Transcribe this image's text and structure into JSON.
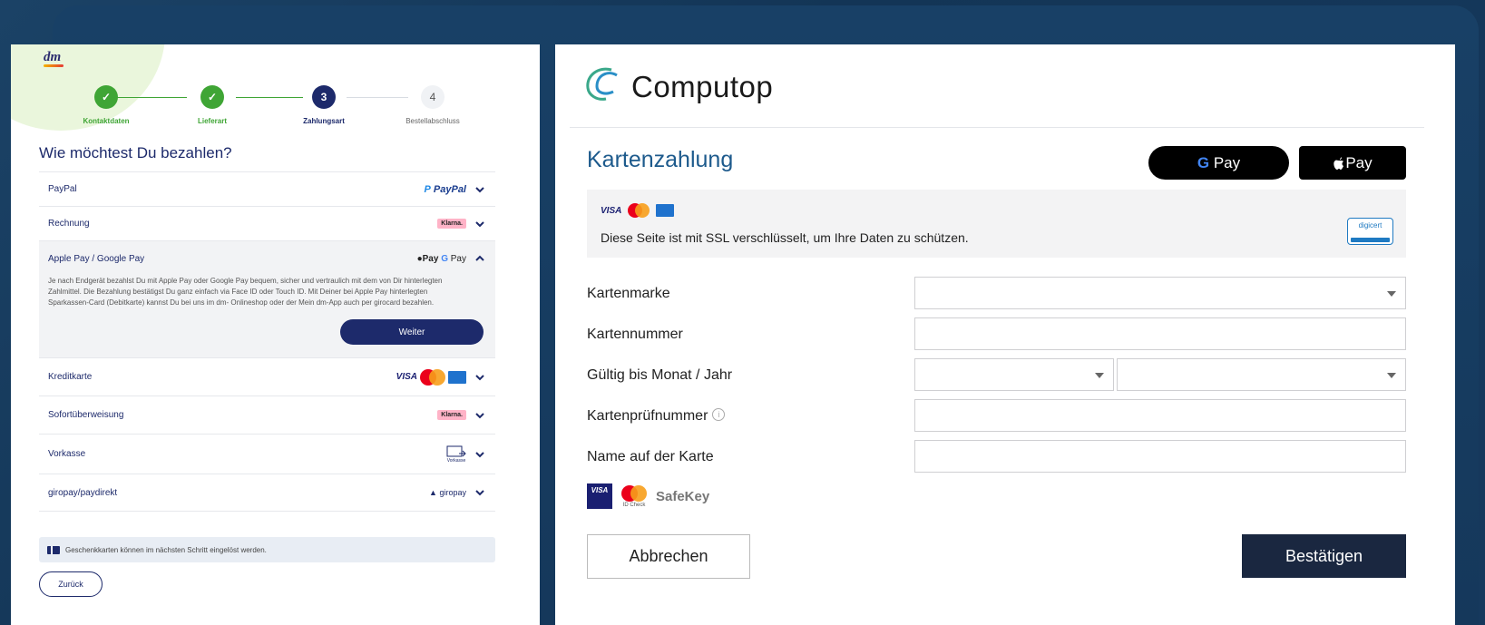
{
  "left": {
    "brand": "dm",
    "steps": [
      {
        "number": "1",
        "label": "Kontaktdaten",
        "state": "done"
      },
      {
        "number": "2",
        "label": "Lieferart",
        "state": "done"
      },
      {
        "number": "3",
        "label": "Zahlungsart",
        "state": "active"
      },
      {
        "number": "4",
        "label": "Bestellabschluss",
        "state": "todo"
      }
    ],
    "heading": "Wie möchtest Du bezahlen?",
    "payment_methods": [
      {
        "name": "PayPal",
        "logo": "PayPal"
      },
      {
        "name": "Rechnung",
        "logo": "Klarna."
      },
      {
        "name": "Apple Pay / Google Pay",
        "logo": "Pay G Pay",
        "expanded": true
      },
      {
        "name": "Kreditkarte",
        "logo": "VISA"
      },
      {
        "name": "Sofortüberweisung",
        "logo": "Klarna."
      },
      {
        "name": "Vorkasse",
        "logo": "Vorkasse"
      },
      {
        "name": "giropay/paydirekt",
        "logo": "giropay"
      }
    ],
    "apple_google_text": "Je nach Endgerät bezahlst Du mit Apple Pay oder Google Pay bequem, sicher und vertraulich mit dem von Dir hinterlegten Zahlmittel. Die Bezahlung bestätigst Du ganz einfach via Face ID oder Touch ID. Mit Deiner bei Apple Pay hinterlegten Sparkassen-Card (Debitkarte) kannst Du bei uns im dm- Onlineshop oder der Mein dm-App auch per girocard bezahlen.",
    "weiter_label": "Weiter",
    "gift_note": "Geschenkkarten können im nächsten Schritt eingelöst werden.",
    "back_label": "Zurück"
  },
  "right": {
    "brand": "Computop",
    "title": "Kartenzahlung",
    "gpay_label": "Pay",
    "apay_label": "Pay",
    "ssl_text": "Diese Seite ist mit SSL verschlüsselt, um Ihre Daten zu schützen.",
    "digicert_label": "digicert",
    "form": [
      {
        "label": "Kartenmarke",
        "type": "select"
      },
      {
        "label": "Kartennummer",
        "type": "text"
      },
      {
        "label": "Gültig bis Monat / Jahr",
        "type": "select-pair"
      },
      {
        "label": "Kartenprüfnummer",
        "type": "text",
        "info": true
      },
      {
        "label": "Name auf der Karte",
        "type": "text"
      }
    ],
    "secure_logos": [
      "VISA",
      "ID Check",
      "SafeKey"
    ],
    "cancel_label": "Abbrechen",
    "confirm_label": "Bestätigen"
  },
  "colors": {
    "background": "#153a5e",
    "dm_navy": "#1d2a6b",
    "dm_green": "#3fa535",
    "computop_blue": "#1d5a8c",
    "confirm_button": "#1a2740"
  }
}
